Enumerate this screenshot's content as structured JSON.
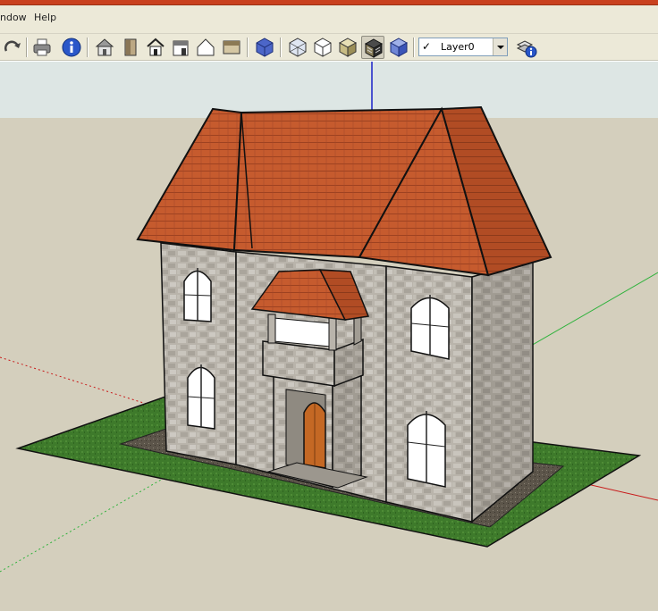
{
  "menu": {
    "items": [
      "ndow",
      "Help"
    ]
  },
  "toolbar": {
    "buttons": [
      "redo-icon",
      "print-icon",
      "model-info-icon",
      "house-icon",
      "door-icon",
      "house-outline-icon",
      "shed-icon",
      "house-gable-icon",
      "panel-icon",
      "iso-view-icon",
      "xray-view-icon",
      "wireframe-view-icon",
      "shaded-view-icon",
      "textured-view-icon",
      "monochrome-view-icon",
      "layers-manager-icon"
    ],
    "pressed_button": "textured-view-icon"
  },
  "layer": {
    "current": "Layer0",
    "visible": "✓"
  },
  "colors": {
    "title_strip": "#c9411e",
    "sky": "#dde6e4",
    "ground": "#d4cfbd",
    "grass": "#3f7a2c",
    "gravel": "#5b5449",
    "stone": "#b7b2aa",
    "roof": "#c4592d",
    "door": "#c46824",
    "axis_blue": "#1a22c8",
    "axis_green": "#2fb23c",
    "axis_red": "#c81a1a"
  }
}
